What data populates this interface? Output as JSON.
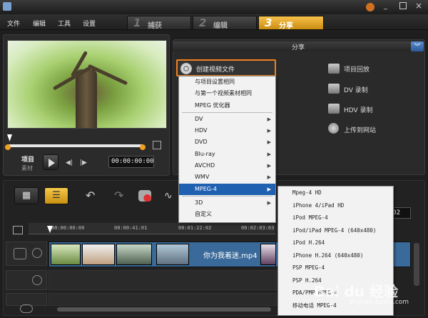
{
  "menubar": {
    "items": [
      "文件",
      "编辑",
      "工具",
      "设置"
    ]
  },
  "steps": [
    {
      "num": "1",
      "label": "捕获"
    },
    {
      "num": "2",
      "label": "编辑"
    },
    {
      "num": "3",
      "label": "分享"
    }
  ],
  "preview": {
    "project_label": "项目",
    "clip_label": "素材",
    "timecode": "00:00:00:00"
  },
  "share": {
    "header": "分享",
    "create_video": "创建视频文件",
    "options": [
      "项目回放",
      "DV 录制",
      "HDV 录制",
      "上传到网站"
    ]
  },
  "timeline": {
    "ruler_ticks": [
      "00:00:00:00",
      "00:00:41:01",
      "00:01:22:02",
      "00:02:03:03"
    ],
    "clip_title": "你为我着迷.mp4",
    "timecode_right": "40:02"
  },
  "menu": {
    "items": [
      {
        "label": "与项目设置相同",
        "submenu": false
      },
      {
        "label": "与第一个视频素材相同",
        "submenu": false
      },
      {
        "label": "MPEG 优化器",
        "submenu": false
      },
      {
        "label": "DV",
        "submenu": true
      },
      {
        "label": "HDV",
        "submenu": true
      },
      {
        "label": "DVD",
        "submenu": true
      },
      {
        "label": "Blu-ray",
        "submenu": true
      },
      {
        "label": "AVCHD",
        "submenu": true
      },
      {
        "label": "WMV",
        "submenu": true
      },
      {
        "label": "MPEG-4",
        "submenu": true,
        "selected": true
      },
      {
        "label": "3D",
        "submenu": true
      },
      {
        "label": "自定义",
        "submenu": false
      }
    ]
  },
  "submenu": {
    "items": [
      "Mpeg-4 HD",
      "iPhone 4/iPad HD",
      "iPod MPEG-4",
      "iPod/iPad MPEG-4 (640x480)",
      "iPod H.264",
      "iPhone H.264 (640x480)",
      "PSP MPEG-4",
      "PSP H.264",
      "PDA/PMP MPEG-4",
      "移动电话 MPEG-4"
    ]
  },
  "watermark": {
    "brand": "Bai du 经验",
    "url": "jingyan.baidu.com"
  },
  "colors": {
    "accent": "#f0a020",
    "highlight_border": "#f08020",
    "menu_selected": "#2060b0"
  }
}
